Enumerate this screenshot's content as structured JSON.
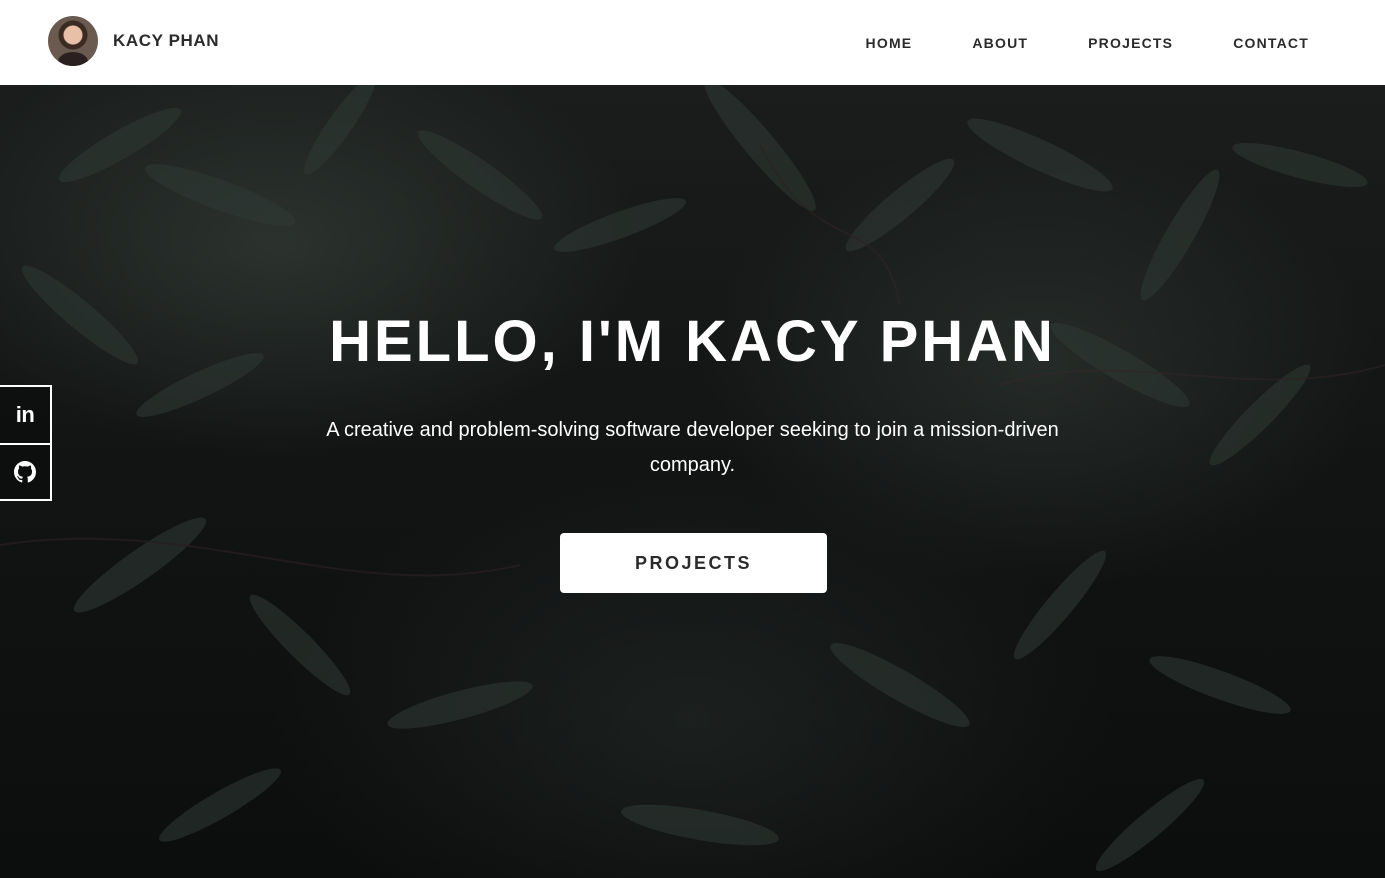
{
  "header": {
    "brand_name": "KACY PHAN",
    "nav": [
      {
        "label": "HOME"
      },
      {
        "label": "ABOUT"
      },
      {
        "label": "PROJECTS"
      },
      {
        "label": "CONTACT"
      }
    ]
  },
  "hero": {
    "title": "HELLO, I'M KACY PHAN",
    "subtitle": "A creative and problem-solving software developer seeking to join a mission-driven company.",
    "button_label": "PROJECTS"
  },
  "social": {
    "linkedin_label": "in",
    "items": [
      {
        "icon": "linkedin-icon"
      },
      {
        "icon": "github-icon"
      }
    ]
  },
  "colors": {
    "header_bg": "#ffffff",
    "nav_text": "#2b2b2b",
    "hero_bg": "#121414",
    "hero_text": "#ffffff",
    "button_bg": "#ffffff"
  }
}
